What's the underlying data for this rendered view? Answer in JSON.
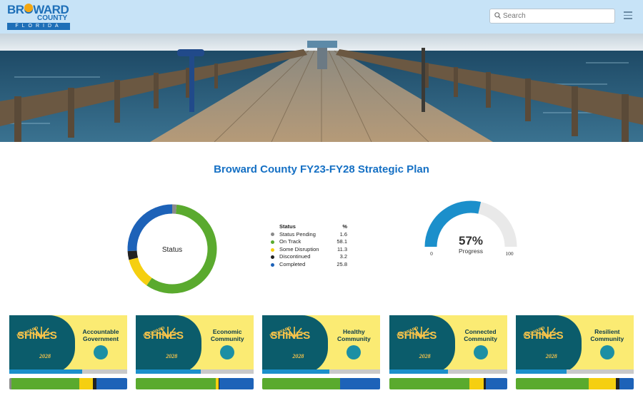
{
  "header": {
    "logo": {
      "line1": "BROWARD",
      "line2": "COUNTY",
      "line3": "FLORIDA"
    },
    "search_placeholder": "Search",
    "search_icon": "search-icon",
    "menu_icon": "hamburger-menu-icon"
  },
  "page": {
    "title": "Broward County FY23-FY28 Strategic Plan"
  },
  "status_chart": {
    "center_label": "Status",
    "header_status": "Status",
    "header_pct": "%",
    "items": [
      {
        "label": "Status Pending",
        "value": "1.6",
        "color": "#8a8a8a"
      },
      {
        "label": "On Track",
        "value": "58.1",
        "color": "#5aaa2e"
      },
      {
        "label": "Some Disruption",
        "value": "11.3",
        "color": "#f5cf10"
      },
      {
        "label": "Discontinued",
        "value": "3.2",
        "color": "#222222"
      },
      {
        "label": "Completed",
        "value": "25.8",
        "color": "#1d62b8"
      }
    ]
  },
  "progress_gauge": {
    "value_text": "57%",
    "label": "Progress",
    "min": "0",
    "max": "100",
    "value": 57,
    "fill_color": "#1b8fcb",
    "track_color": "#e9e9e9"
  },
  "cards": [
    {
      "title_line1": "Accountable",
      "title_line2": "Government",
      "brand": "SHINES",
      "brand_top": "BROWARD",
      "year": "2028",
      "progress": 0.62,
      "status": [
        1.6,
        58.1,
        11.3,
        3.2,
        25.8
      ]
    },
    {
      "title_line1": "Economic",
      "title_line2": "Community",
      "brand": "SHINES",
      "brand_top": "BROWARD",
      "year": "2028",
      "progress": 0.55,
      "status": [
        0,
        68,
        2,
        1,
        29
      ]
    },
    {
      "title_line1": "Healthy",
      "title_line2": "Community",
      "brand": "SHINES",
      "brand_top": "BROWARD",
      "year": "2028",
      "progress": 0.57,
      "status": [
        0,
        66,
        0,
        0,
        34
      ]
    },
    {
      "title_line1": "Connected",
      "title_line2": "Community",
      "brand": "SHINES",
      "brand_top": "BROWARD",
      "year": "2028",
      "progress": 0.5,
      "status": [
        0,
        68,
        12,
        2,
        18
      ]
    },
    {
      "title_line1": "Resilient",
      "title_line2": "Community",
      "brand": "SHINES",
      "brand_top": "BROWARD",
      "year": "2028",
      "progress": 0.43,
      "status": [
        0,
        62,
        23,
        3,
        12
      ]
    }
  ],
  "colors": {
    "pending": "#8a8a8a",
    "on_track": "#5aaa2e",
    "disruption": "#f5cf10",
    "discontinued": "#222222",
    "completed": "#1d62b8"
  }
}
